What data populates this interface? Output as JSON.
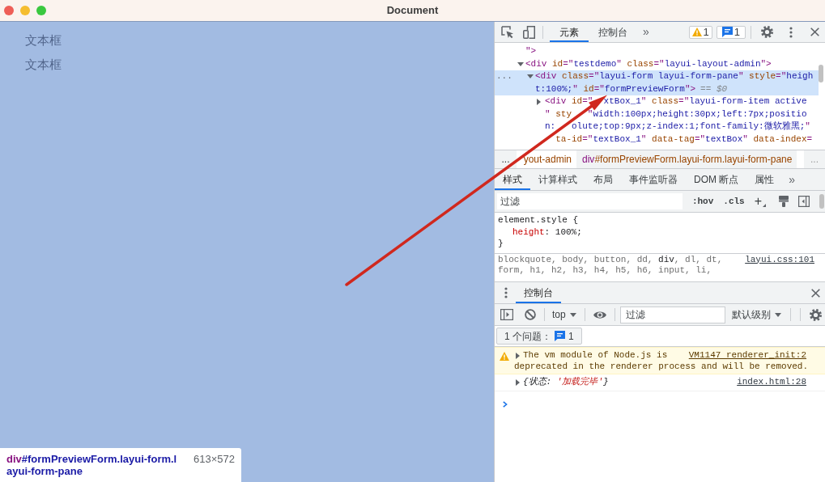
{
  "window": {
    "title": "Document"
  },
  "page": {
    "fields": [
      {
        "label": "文本框"
      },
      {
        "label": "文本框"
      }
    ]
  },
  "inspect_tooltip": {
    "tag": "div",
    "selector": "#formPreviewForm.layui-form.layui-form-pane",
    "size": "613×572"
  },
  "devtools": {
    "main_tabs": [
      {
        "label": "元素",
        "selected": true
      },
      {
        "label": "控制台",
        "selected": false
      }
    ],
    "main_tabs_more": "»",
    "counters": [
      {
        "kind": "warning",
        "count": "1"
      },
      {
        "kind": "message",
        "count": "1"
      }
    ],
    "row_menu": "...",
    "dom_tree": [
      {
        "kind": "tail",
        "selected": false,
        "lines": [
          "\">"
        ]
      },
      {
        "kind": "tag",
        "expanded": true,
        "selected": false,
        "lines": [
          "<div id=\"testdemo\" class=\"layui-layout-admin\">"
        ],
        "children": [
          {
            "kind": "tag",
            "expanded": true,
            "selected": true,
            "lines": [
              "<div class=\"layui-form layui-form-pane\" style=\"heigh",
              "t:100%;\" id=\"formPreviewForm\">"
            ],
            "suffix": "== *$0*",
            "children": [
              {
                "kind": "tag",
                "expanded": false,
                "selected": false,
                "lines": [
                  "<div id=\"  xtBox_1\" class=\"layui-form-item active",
                  "\" sty   \"width:100px;height:30px;left:7px;positio",
                  "n:   olute;top:9px;z-index:1;font-family:微软雅黑;\"",
                  "  ta-id=\"textBox_1\" data-tag=\"textBox\" data-index="
                ]
              }
            ]
          }
        ]
      }
    ],
    "breadcrumbs": {
      "scroll_left": "...",
      "items": [
        {
          "text": "  yout-admin",
          "selected": false
        },
        {
          "tag": "div",
          "text": "#formPreviewForm.layui-form.layui-form-pane",
          "selected": true
        }
      ],
      "scroll_right": "..."
    },
    "sidebar_tabs": [
      {
        "label": "样式",
        "selected": true
      },
      {
        "label": "计算样式",
        "selected": false
      },
      {
        "label": "布局",
        "selected": false
      },
      {
        "label": "事件监听器",
        "selected": false
      },
      {
        "label": "DOM 断点",
        "selected": false
      },
      {
        "label": "属性",
        "selected": false
      }
    ],
    "sidebar_tabs_more": "»",
    "styles_filter": {
      "placeholder": "过滤"
    },
    "style_toggles": [
      {
        "label": ":hov",
        "kind": "toggle"
      },
      {
        "label": ".cls",
        "kind": "toggle"
      },
      {
        "label": "+",
        "kind": "menu"
      }
    ],
    "rules": [
      {
        "kind": "inline",
        "selector": "element.style {",
        "declarations": [
          "height: 100%;"
        ],
        "close": "}"
      },
      {
        "kind": "stylesheet",
        "source": "layui.css:101",
        "selector_lines": [
          [
            {
              "text": "blockquote, body, button, dd, ",
              "matched": false
            },
            {
              "text": "div",
              "matched": true
            },
            {
              "text": ", dl, dt,",
              "matched": false
            }
          ],
          [
            {
              "text": "form, h1, h2, h3, h4, h5, h6, input, li,",
              "matched": false
            }
          ]
        ]
      }
    ]
  },
  "console_drawer": {
    "tabs": [
      {
        "label": "控制台",
        "selected": true
      }
    ],
    "context": "top",
    "filter": {
      "placeholder": "过滤"
    },
    "level": "默认级别",
    "issues": {
      "label": "1 个问题：",
      "count": "1"
    },
    "messages": [
      {
        "kind": "warning",
        "expanded": false,
        "lines": [
          [
            {
              "text": "The vm module of Node.js is",
              "kind": "plain"
            }
          ],
          [
            {
              "text": "deprecated in the renderer process and will be removed.",
              "kind": "plain"
            }
          ]
        ],
        "source": "VM1147 renderer_init:2"
      },
      {
        "kind": "object",
        "expanded": false,
        "lines": [
          [
            {
              "text": "{状态: ",
              "kind": "plain"
            },
            {
              "text": "'加载完毕'",
              "kind": "string"
            },
            {
              "text": "}",
              "kind": "plain"
            }
          ]
        ],
        "source": "index.html:28"
      }
    ]
  }
}
